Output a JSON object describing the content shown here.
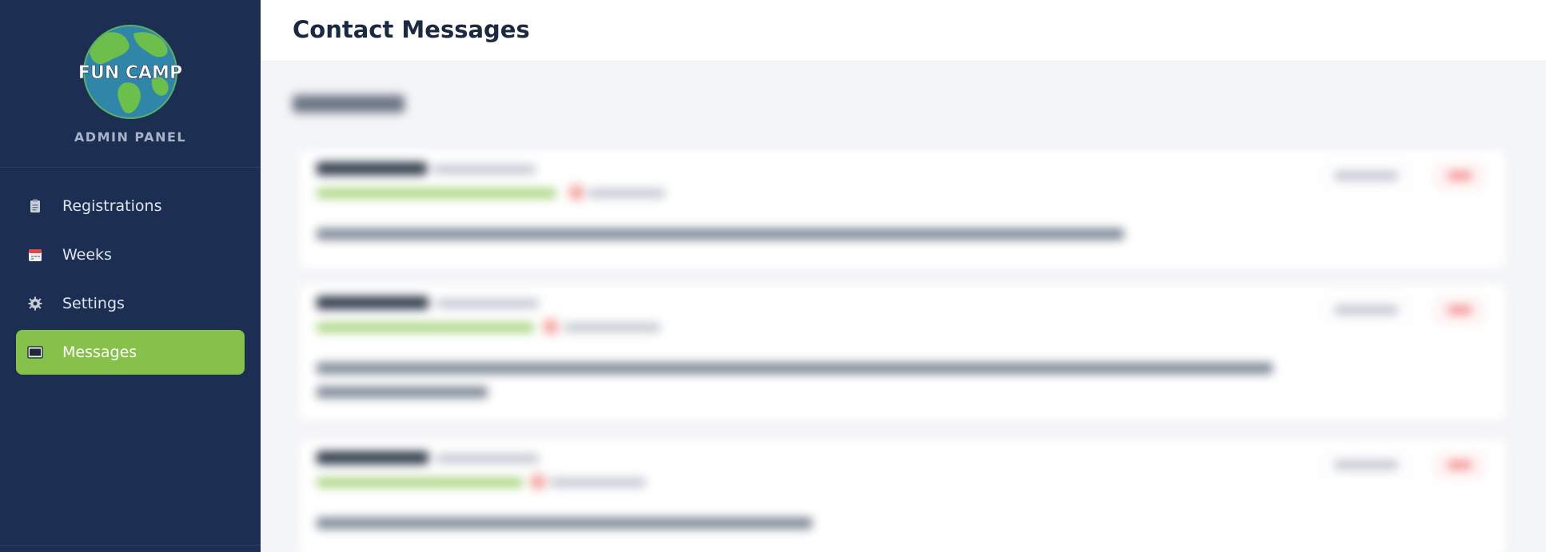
{
  "sidebar": {
    "logo_text": "FUN CAMP",
    "admin_label": "ADMIN PANEL",
    "items": [
      {
        "label": "Registrations",
        "icon": "clipboard-icon"
      },
      {
        "label": "Weeks",
        "icon": "calendar-icon"
      },
      {
        "label": "Settings",
        "icon": "gear-icon"
      },
      {
        "label": "Messages",
        "icon": "envelope-icon",
        "active": true
      }
    ]
  },
  "header": {
    "title": "Contact Messages"
  },
  "colors": {
    "sidebar_bg": "#1c2f52",
    "accent": "#86c24a"
  }
}
